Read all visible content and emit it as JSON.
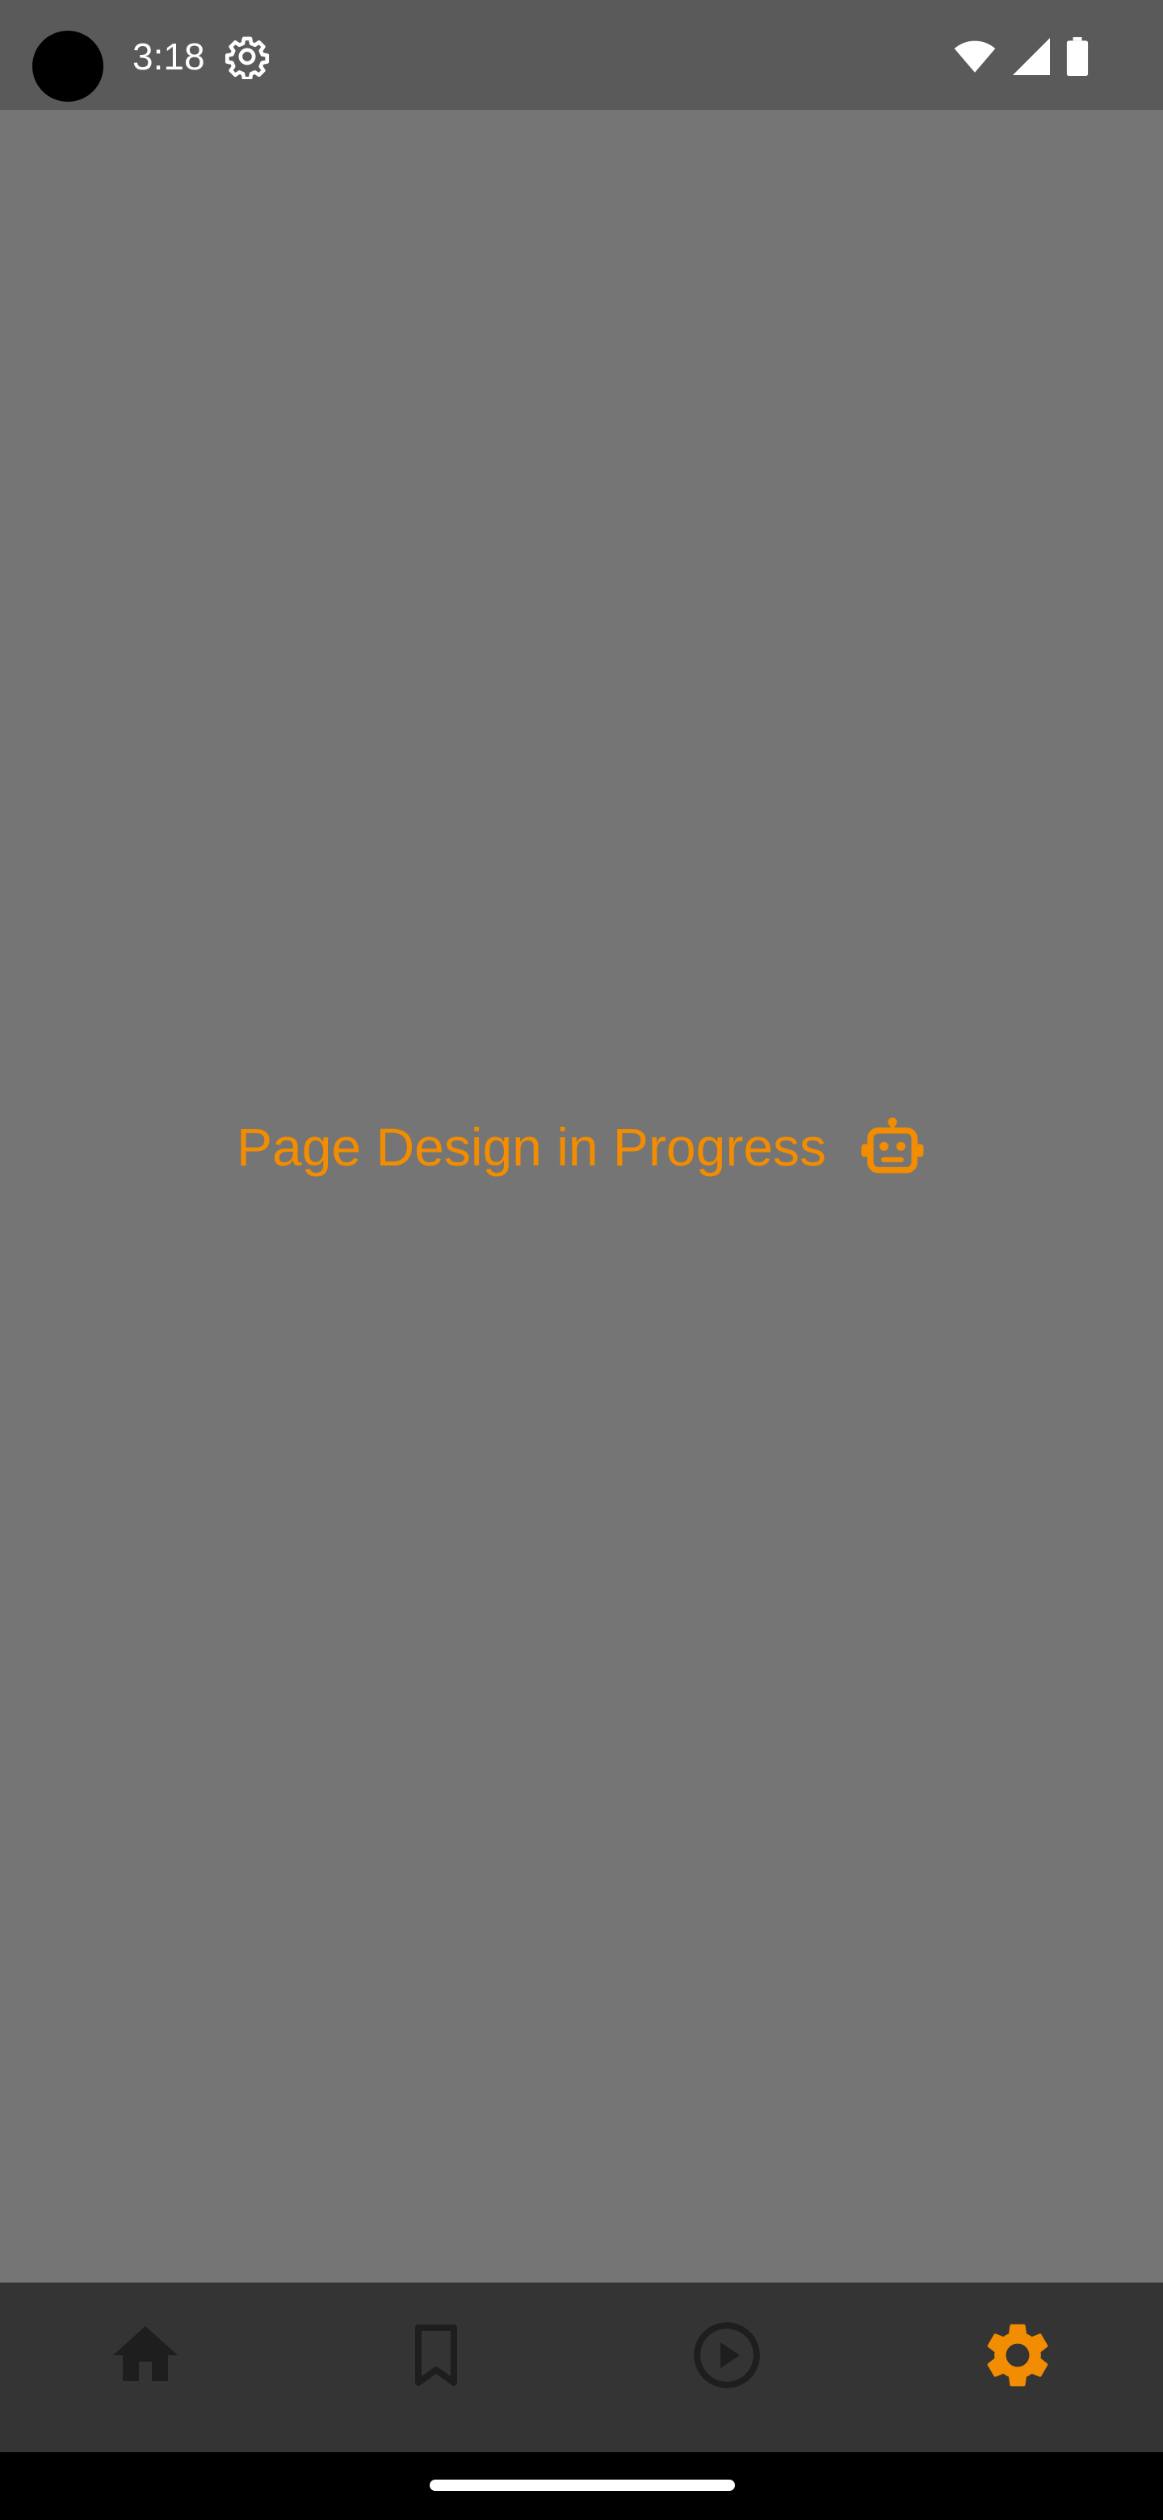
{
  "status_bar": {
    "time": "3:18",
    "icons": [
      "gear-icon",
      "wifi-icon",
      "cellular-signal-icon",
      "battery-icon"
    ]
  },
  "content": {
    "message": "Page Design in Progress",
    "message_icon": "robot-icon"
  },
  "bottom_nav": {
    "items": [
      {
        "icon": "home-icon",
        "active": false
      },
      {
        "icon": "bookmark-icon",
        "active": false
      },
      {
        "icon": "play-circle-icon",
        "active": false
      },
      {
        "icon": "settings-icon",
        "active": true
      }
    ]
  },
  "colors": {
    "accent": "#f28c00",
    "status_bar_bg": "#5a5a5a",
    "content_bg": "#757575",
    "nav_bg": "#343434",
    "nav_icon_inactive": "#1e1e1e"
  }
}
